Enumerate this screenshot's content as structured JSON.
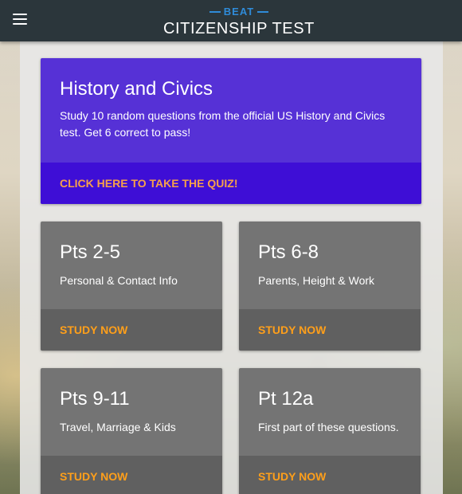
{
  "header": {
    "menu_icon": "hamburger-menu-icon",
    "logo_top": "BEAT",
    "logo_bottom": "CITIZENSHIP TEST",
    "background_color": "#2b363b",
    "logo_accent_color": "#2f8bd8"
  },
  "hero_card": {
    "title": "History and Civics",
    "description": "Study 10 random questions from the official US History and Civics test. Get 6 correct to pass!",
    "action": "CLICK HERE TO TAKE THE QUIZ!",
    "background_color": "#5631d6",
    "action_color": "#f6a04b"
  },
  "cards": [
    {
      "title": "Pts 2-5",
      "description": "Personal & Contact Info",
      "action": "STUDY NOW"
    },
    {
      "title": "Pts 6-8",
      "description": "Parents, Height & Work",
      "action": "STUDY NOW"
    },
    {
      "title": "Pts 9-11",
      "description": "Travel, Marriage & Kids",
      "action": "STUDY NOW"
    },
    {
      "title": "Pt 12a",
      "description": "First part of these questions.",
      "action": "STUDY NOW"
    }
  ],
  "card_colors": {
    "background": "#747474",
    "action_background": "#606060",
    "action_text": "#ff9f1a"
  }
}
